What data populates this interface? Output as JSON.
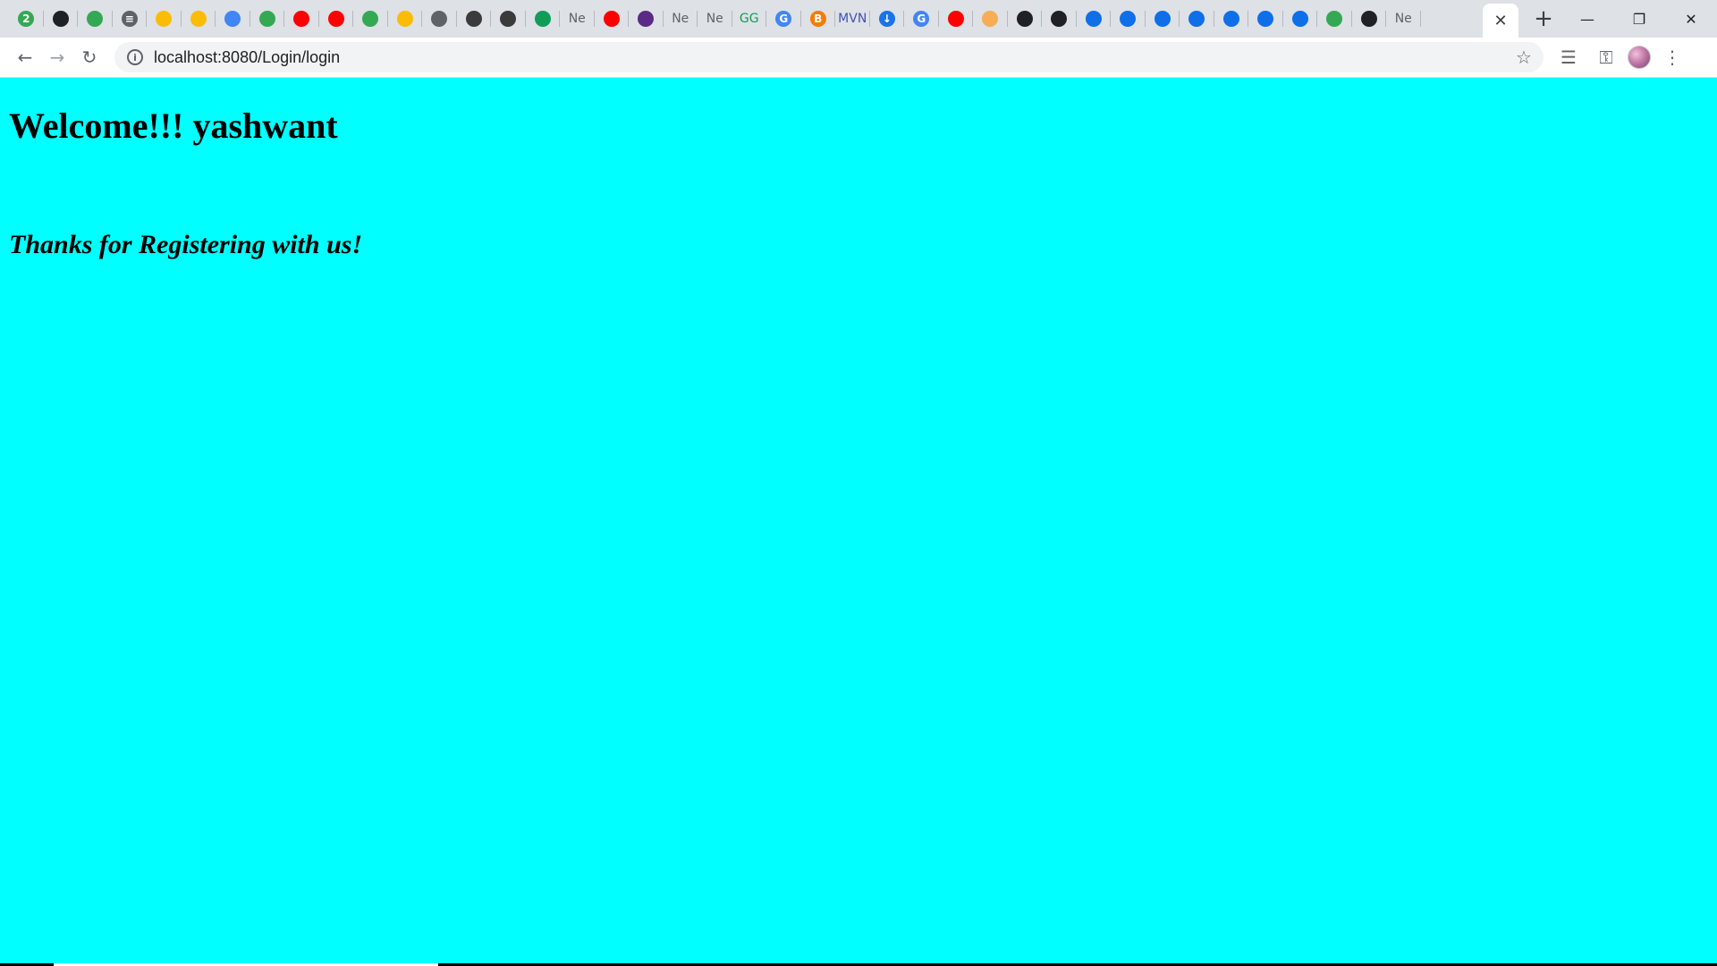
{
  "browser": {
    "tabs": [
      {
        "icon": "badge-2-icon",
        "glyph": "2",
        "color": "#34a853"
      },
      {
        "icon": "github-icon",
        "glyph": "",
        "color": "#202124"
      },
      {
        "icon": "github-outline-icon",
        "glyph": "",
        "color": "#34a853"
      },
      {
        "icon": "menu-lines-icon",
        "glyph": "≡",
        "color": "#5f6368"
      },
      {
        "icon": "gift-icon",
        "glyph": "",
        "color": "#fbbc04"
      },
      {
        "icon": "google-drive-icon",
        "glyph": "",
        "color": "#fbbc04"
      },
      {
        "icon": "google-docs-icon",
        "glyph": "",
        "color": "#4285f4"
      },
      {
        "icon": "shield-icon",
        "glyph": "",
        "color": "#34a853"
      },
      {
        "icon": "youtube-icon",
        "glyph": "",
        "color": "#ff0000"
      },
      {
        "icon": "youtube-icon",
        "glyph": "",
        "color": "#ff0000"
      },
      {
        "icon": "shield-icon",
        "glyph": "",
        "color": "#34a853"
      },
      {
        "icon": "google-drive-icon",
        "glyph": "",
        "color": "#fbbc04"
      },
      {
        "icon": "globe-icon",
        "glyph": "",
        "color": "#5f6368"
      },
      {
        "icon": "image-icon",
        "glyph": "",
        "color": "#3b3b3b"
      },
      {
        "icon": "image-icon",
        "glyph": "",
        "color": "#3b3b3b"
      },
      {
        "icon": "rocket-icon",
        "glyph": "",
        "color": "#0f9d58"
      },
      {
        "icon": "text-ne-icon",
        "glyph": "Ne",
        "color": "#5f6368"
      },
      {
        "icon": "youtube-icon",
        "glyph": "",
        "color": "#ff0000"
      },
      {
        "icon": "bolt-icon",
        "glyph": "",
        "color": "#5b2a86"
      },
      {
        "icon": "text-ne-icon",
        "glyph": "Ne",
        "color": "#5f6368"
      },
      {
        "icon": "text-ne-icon",
        "glyph": "Ne",
        "color": "#5f6368"
      },
      {
        "icon": "geeksforgeeks-icon",
        "glyph": "GG",
        "color": "#0f9d58"
      },
      {
        "icon": "google-icon",
        "glyph": "G",
        "color": "#4285f4"
      },
      {
        "icon": "blogger-icon",
        "glyph": "B",
        "color": "#f57c00"
      },
      {
        "icon": "mvn-icon",
        "glyph": "MVN",
        "color": "#3f51b5"
      },
      {
        "icon": "download-icon",
        "glyph": "↓",
        "color": "#1a73e8"
      },
      {
        "icon": "google-icon",
        "glyph": "G",
        "color": "#4285f4"
      },
      {
        "icon": "youtube-icon",
        "glyph": "",
        "color": "#ff0000"
      },
      {
        "icon": "hand-icon",
        "glyph": "",
        "color": "#f6ad55"
      },
      {
        "icon": "github-icon",
        "glyph": "",
        "color": "#202124"
      },
      {
        "icon": "github-icon",
        "glyph": "",
        "color": "#202124"
      },
      {
        "icon": "teamviewer-icon",
        "glyph": "",
        "color": "#0e6fe8"
      },
      {
        "icon": "teamviewer-icon",
        "glyph": "",
        "color": "#0e6fe8"
      },
      {
        "icon": "teamviewer-icon",
        "glyph": "",
        "color": "#0e6fe8"
      },
      {
        "icon": "teamviewer-icon",
        "glyph": "",
        "color": "#0e6fe8"
      },
      {
        "icon": "teamviewer-icon",
        "glyph": "",
        "color": "#0e6fe8"
      },
      {
        "icon": "teamviewer-icon",
        "glyph": "",
        "color": "#0e6fe8"
      },
      {
        "icon": "teamviewer-icon",
        "glyph": "",
        "color": "#0e6fe8"
      },
      {
        "icon": "mixed-color-icon",
        "glyph": "",
        "color": "#34a853"
      },
      {
        "icon": "github-icon",
        "glyph": "",
        "color": "#202124"
      },
      {
        "icon": "text-ne-icon",
        "glyph": "Ne",
        "color": "#5f6368"
      }
    ],
    "active_tab": {
      "close_glyph": "✕"
    },
    "new_tab_glyph": "+",
    "window_controls": {
      "minimize": "—",
      "restore": "❐",
      "close": "✕"
    },
    "nav": {
      "back": "←",
      "forward": "→",
      "reload": "↻"
    },
    "address_bar": {
      "url": "localhost:8080/Login/login",
      "info_glyph": "i",
      "star_glyph": "☆"
    },
    "right_tools": {
      "reading_list_glyph": "☰",
      "key_glyph": "⚿",
      "menu_glyph": "⋮"
    }
  },
  "page": {
    "background": "#00ffff",
    "welcome_text": "Welcome!!! yashwant",
    "thanks_text": "Thanks for Registering with us!"
  }
}
